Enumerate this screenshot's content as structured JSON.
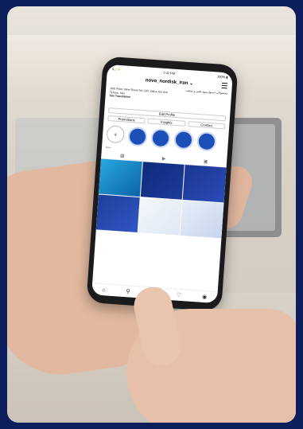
{
  "status_bar": {
    "carrier": "ll □ ⚡",
    "time": "7:42 PM",
    "battery": "100% ▮"
  },
  "profile": {
    "username": "novo_nordisk_iran ⌄"
  },
  "bio": [
    "محصولات استوارسهه طبی و صنعت",
    "16th Floor, Nine Tower No 230, Vali-e-Asr Ave",
    "Tehran, Iran",
    "See Translation"
  ],
  "buttons": {
    "edit_profile": "Edit Profile",
    "promotions": "Promotions",
    "insights": "Insights",
    "contact": "Contact"
  },
  "highlights": {
    "new_label": "New",
    "new_icon": "+"
  },
  "bottom_nav_icons": [
    "home-icon",
    "search-icon",
    "reels-icon",
    "heart-icon",
    "profile-icon"
  ]
}
